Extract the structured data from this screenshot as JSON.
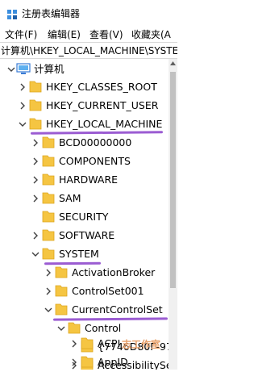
{
  "window": {
    "title": "注册表编辑器"
  },
  "menu": [
    {
      "label": "文件(F)"
    },
    {
      "label": "编辑(E)"
    },
    {
      "label": "查看(V)"
    },
    {
      "label": "收藏夹(A"
    }
  ],
  "address": {
    "path": "计算机\\HKEY_LOCAL_MACHINE\\SYSTEM"
  },
  "tree": {
    "root": {
      "label": "计算机"
    },
    "hkcr": {
      "label": "HKEY_CLASSES_ROOT"
    },
    "hkcu": {
      "label": "HKEY_CURRENT_USER"
    },
    "hklm": {
      "label": "HKEY_LOCAL_MACHINE"
    },
    "bcd": {
      "label": "BCD00000000"
    },
    "components": {
      "label": "COMPONENTS"
    },
    "hardware": {
      "label": "HARDWARE"
    },
    "sam": {
      "label": "SAM"
    },
    "security": {
      "label": "SECURITY"
    },
    "software": {
      "label": "SOFTWARE"
    },
    "system": {
      "label": "SYSTEM"
    },
    "activation_broker": {
      "label": "ActivationBroker"
    },
    "controlset001": {
      "label": "ControlSet001"
    },
    "current_control_set": {
      "label": "CurrentControlSet"
    },
    "control": {
      "label": "Control"
    },
    "guid": {
      "label": "{7746D80F-97"
    },
    "accessibility": {
      "label": "AccessibilitySe"
    },
    "acpi": {
      "label": "ACPI"
    },
    "appid": {
      "label": "AppID"
    }
  },
  "watermark": {
    "text": "志工作室"
  },
  "colors": {
    "folder": "#f5c542",
    "highlight_underline": "#9b5cd2",
    "watermark": "#e8a06a"
  }
}
